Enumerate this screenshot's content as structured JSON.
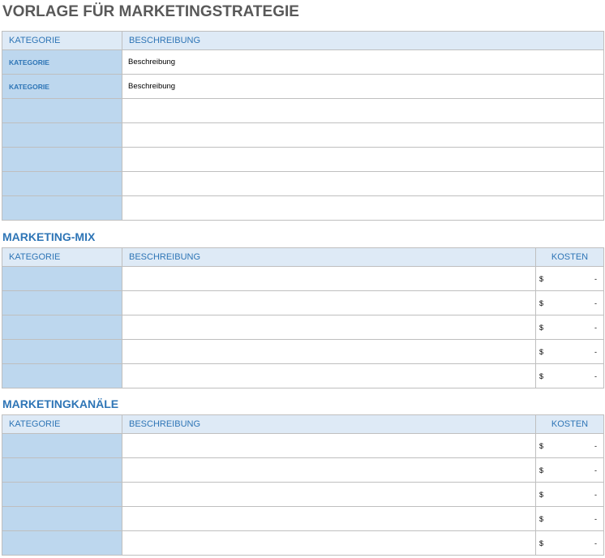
{
  "title": "VORLAGE FÜR MARKETINGSTRATEGIE",
  "strategy": {
    "headers": {
      "category": "KATEGORIE",
      "description": "BESCHREIBUNG"
    },
    "rows": [
      {
        "category": "KATEGORIE",
        "description": "Beschreibung"
      },
      {
        "category": "KATEGORIE",
        "description": "Beschreibung"
      },
      {
        "category": "",
        "description": ""
      },
      {
        "category": "",
        "description": ""
      },
      {
        "category": "",
        "description": ""
      },
      {
        "category": "",
        "description": ""
      },
      {
        "category": "",
        "description": ""
      }
    ]
  },
  "marketing_mix": {
    "title": "MARKETING-MIX",
    "headers": {
      "category": "KATEGORIE",
      "description": "BESCHREIBUNG",
      "cost": "KOSTEN"
    },
    "rows": [
      {
        "category": "",
        "description": "",
        "currency": "$",
        "cost": "-"
      },
      {
        "category": "",
        "description": "",
        "currency": "$",
        "cost": "-"
      },
      {
        "category": "",
        "description": "",
        "currency": "$",
        "cost": "-"
      },
      {
        "category": "",
        "description": "",
        "currency": "$",
        "cost": "-"
      },
      {
        "category": "",
        "description": "",
        "currency": "$",
        "cost": "-"
      }
    ]
  },
  "channels": {
    "title": "MARKETINGKANÄLE",
    "headers": {
      "category": "KATEGORIE",
      "description": "BESCHREIBUNG",
      "cost": "KOSTEN"
    },
    "rows": [
      {
        "category": "",
        "description": "",
        "currency": "$",
        "cost": "-"
      },
      {
        "category": "",
        "description": "",
        "currency": "$",
        "cost": "-"
      },
      {
        "category": "",
        "description": "",
        "currency": "$",
        "cost": "-"
      },
      {
        "category": "",
        "description": "",
        "currency": "$",
        "cost": "-"
      },
      {
        "category": "",
        "description": "",
        "currency": "$",
        "cost": "-"
      }
    ]
  },
  "colors": {
    "title": "#595959",
    "accent": "#2e75b6",
    "header_fill": "#deeaf6",
    "category_fill": "#bdd7ee",
    "border": "#bfbfbf"
  }
}
